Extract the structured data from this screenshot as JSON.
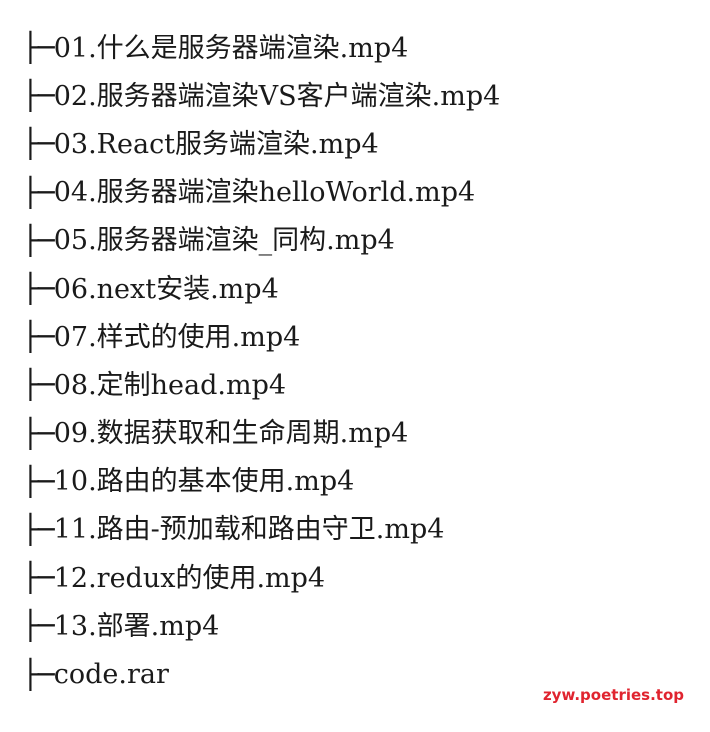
{
  "tree": {
    "branch_glyph": "├─",
    "items": [
      "01.什么是服务器端渲染.mp4",
      "02.服务器端渲染VS客户端渲染.mp4",
      "03.React服务端渲染.mp4",
      "04.服务器端渲染helloWorld.mp4",
      "05.服务器端渲染_同构.mp4",
      "06.next安装.mp4",
      "07.样式的使用.mp4",
      "08.定制head.mp4",
      "09.数据获取和生命周期.mp4",
      "10.路由的基本使用.mp4",
      "11.路由-预加载和路由守卫.mp4",
      "12.redux的使用.mp4",
      "13.部署.mp4",
      "code.rar"
    ]
  },
  "watermark": {
    "text": "zyw.poetries.top",
    "color": "#e0242f"
  }
}
